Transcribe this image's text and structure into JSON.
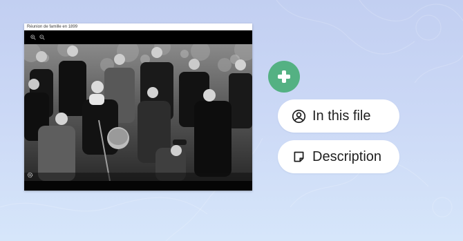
{
  "viewer": {
    "title": "Réunion de famille en 1899",
    "toolbar": {
      "zoom_in_icon": "zoom-in-icon",
      "zoom_out_icon": "zoom-out-icon"
    },
    "photo": "black-and-white group portrait of a family, two rows standing and seated in front of trees",
    "corner_icon": "gear-icon"
  },
  "actions": {
    "add_button": {
      "icon": "plus-icon",
      "color": "#54b183"
    },
    "people_chip": {
      "label": "In this file",
      "icon": "person-circle-icon"
    },
    "description_chip": {
      "label": "Description",
      "icon": "note-icon"
    }
  },
  "colors": {
    "background": "#c9d6f4",
    "accent": "#54b183",
    "chip_bg": "#ffffff",
    "text": "#1f1f1f"
  }
}
